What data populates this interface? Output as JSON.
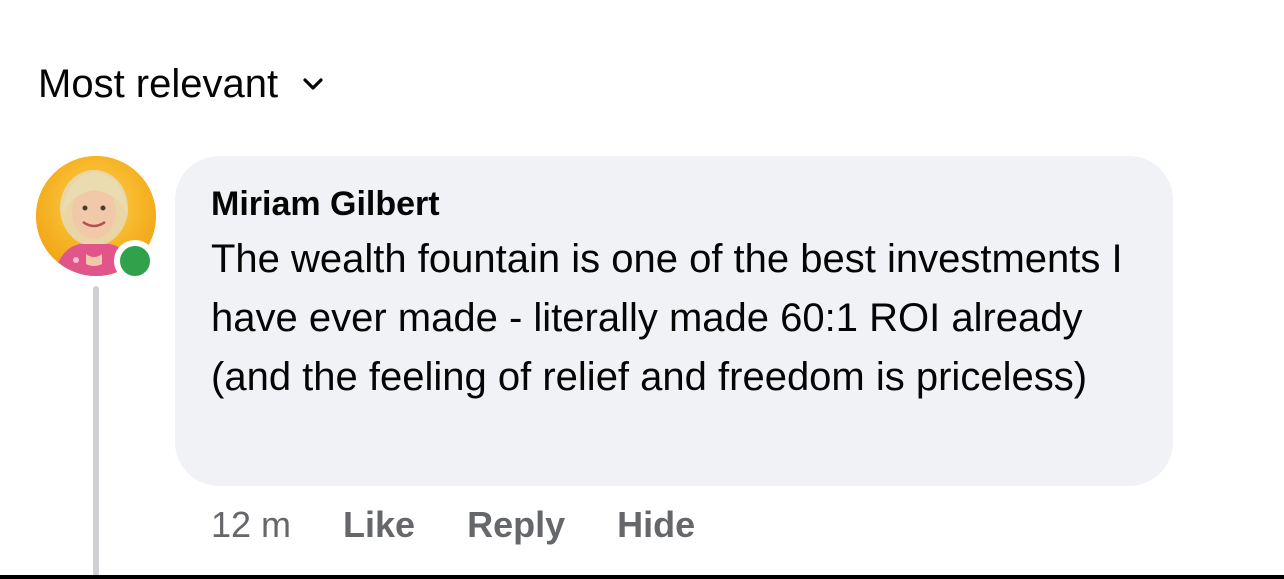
{
  "sort": {
    "label": "Most relevant",
    "icon": "chevron-down-icon"
  },
  "comment": {
    "author": "Miriam Gilbert",
    "text": "The wealth fountain is one of the best investments I have ever made - literally made 60:1 ROI already (and the feeling of relief and freedom is priceless)",
    "timestamp": "12 m",
    "actions": {
      "like": "Like",
      "reply": "Reply",
      "hide": "Hide"
    },
    "online": true
  },
  "colors": {
    "bubble": "#f0f2f5",
    "secondary_text": "#65676b",
    "online": "#31a24c",
    "avatar_ring": "#f4b41a"
  }
}
